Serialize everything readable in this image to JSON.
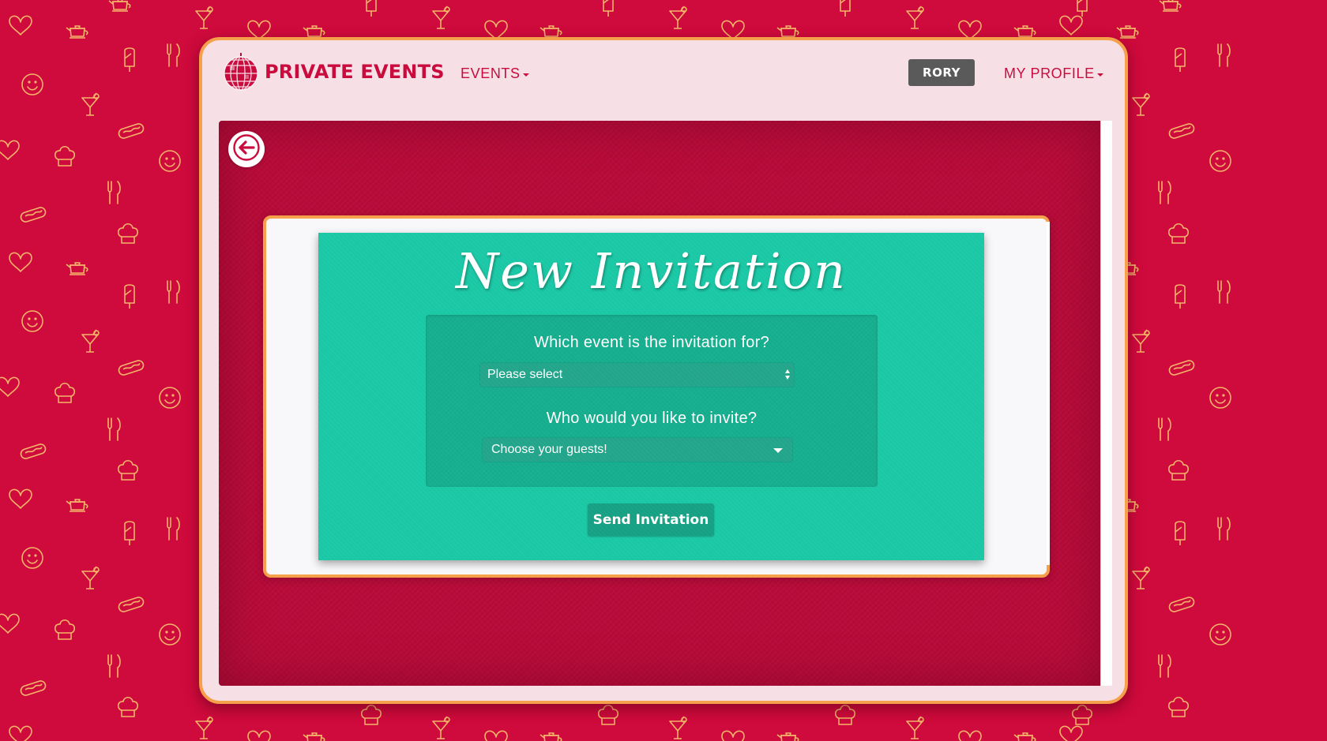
{
  "navbar": {
    "brand_name": "PRIVATE EVENTS",
    "brand_icon": "disco-ball-icon",
    "events_menu_label": "EVENTS",
    "user_badge_label": "RORY",
    "profile_menu_label": "MY PROFILE"
  },
  "page": {
    "back_icon": "arrow-left-icon",
    "title": "New Invitation"
  },
  "form": {
    "event_question": "Which event is the invitation for?",
    "event_select_value": "Please select",
    "guest_question": "Who would you like to invite?",
    "guest_select_value": "Choose your guests!",
    "submit_label": "Send Invitation"
  },
  "background": {
    "pattern_icons": [
      "heart-icon",
      "teapot-icon",
      "cocktail-icon",
      "fork-knife-icon",
      "popsicle-icon",
      "smiley-icon",
      "chef-hat-icon",
      "hotdog-icon"
    ]
  },
  "colors": {
    "background": "#cf0a3c",
    "accent": "#c90b3e",
    "frame_border": "#f5a04a",
    "card": "#1bc8a6",
    "user_badge": "#5a5a5a"
  }
}
